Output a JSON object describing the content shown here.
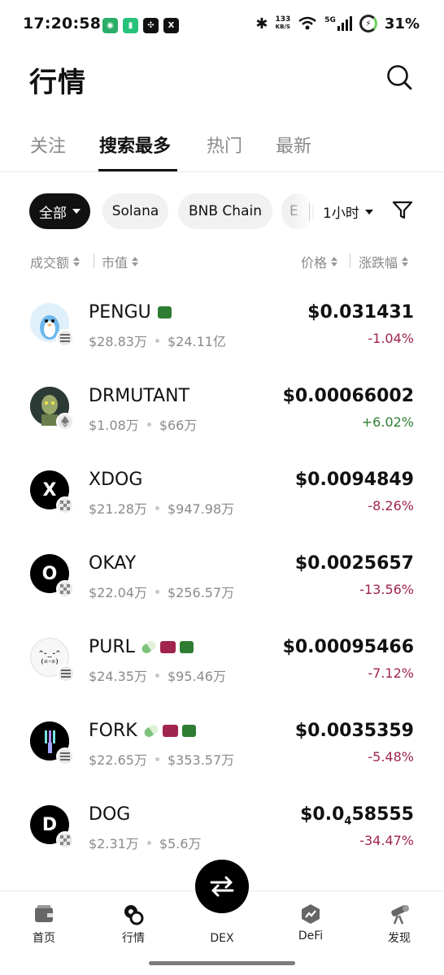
{
  "status_bar": {
    "time": "17:20:58",
    "net_speed_value": "133",
    "net_speed_unit": "KB/S",
    "network": "5G",
    "battery": "31%"
  },
  "header": {
    "title": "行情"
  },
  "tabs": [
    {
      "label": "关注"
    },
    {
      "label": "搜索最多"
    },
    {
      "label": "热门"
    },
    {
      "label": "最新"
    }
  ],
  "chips": {
    "all": "全部",
    "solana": "Solana",
    "bnb": "BNB Chain",
    "partial": "E",
    "time_range": "1小时"
  },
  "columns": {
    "volume": "成交额",
    "market_cap": "市值",
    "price": "价格",
    "change": "涨跌幅"
  },
  "tokens": [
    {
      "name": "PENGU",
      "volume": "$28.83万",
      "market_cap": "$24.11亿",
      "price": "$0.031431",
      "change": "-1.04%",
      "direction": "down",
      "chain": "solana-icon"
    },
    {
      "name": "DRMUTANT",
      "volume": "$1.08万",
      "market_cap": "$66万",
      "price": "$0.00066002",
      "change": "+6.02%",
      "direction": "up",
      "chain": "ethereum-icon"
    },
    {
      "name": "XDOG",
      "volume": "$21.28万",
      "market_cap": "$947.98万",
      "price": "$0.0094849",
      "change": "-8.26%",
      "direction": "down",
      "chain": "xlayer-icon",
      "letter": "X"
    },
    {
      "name": "OKAY",
      "volume": "$22.04万",
      "market_cap": "$256.57万",
      "price": "$0.0025657",
      "change": "-13.56%",
      "direction": "down",
      "chain": "xlayer-icon",
      "letter": "O"
    },
    {
      "name": "PURL",
      "volume": "$24.35万",
      "market_cap": "$95.46万",
      "price": "$0.00095466",
      "change": "-7.12%",
      "direction": "down",
      "chain": "solana-icon"
    },
    {
      "name": "FORK",
      "volume": "$22.65万",
      "market_cap": "$353.57万",
      "price": "$0.0035359",
      "change": "-5.48%",
      "direction": "down",
      "chain": "solana-icon"
    },
    {
      "name": "DOG",
      "volume": "$2.31万",
      "market_cap": "$5.6万",
      "price_prefix": "$0.0",
      "price_subscript": "4",
      "price_rest": "58555",
      "change": "-34.47%",
      "direction": "down",
      "chain": "xlayer-icon",
      "letter": "D"
    }
  ],
  "bottom_nav": {
    "home": "首页",
    "market": "行情",
    "dex": "DEX",
    "defi": "DeFi",
    "discover": "发现"
  },
  "colors": {
    "up": "#2e7d32",
    "down": "#a0244d",
    "accent": "#111111"
  }
}
